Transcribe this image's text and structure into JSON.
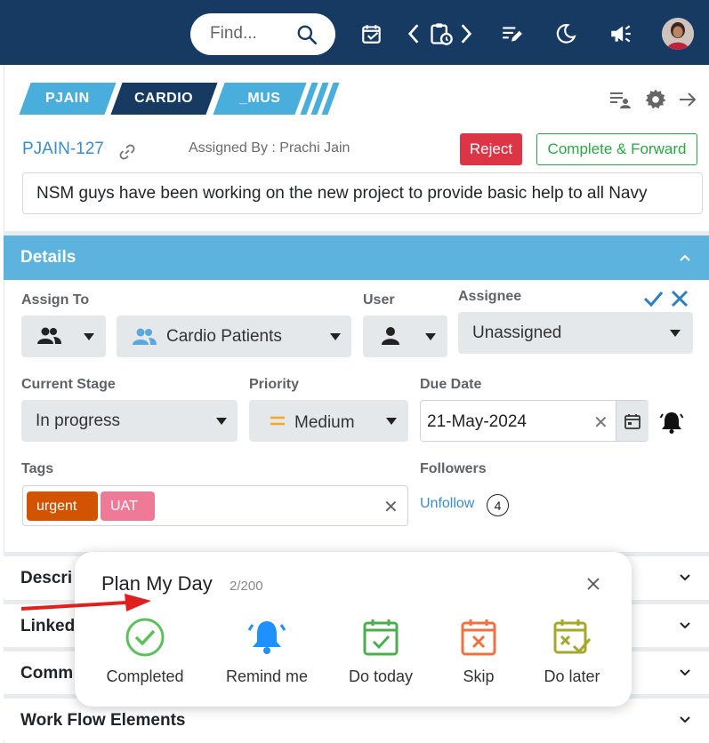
{
  "topbar": {
    "search_placeholder": "Find...",
    "icons": [
      "search-icon",
      "calendar-check-icon",
      "chevron-left-icon",
      "clipboard-clock-icon",
      "chevron-right-icon",
      "list-edit-icon",
      "moon-icon",
      "megaphone-icon"
    ]
  },
  "task": {
    "chips": [
      "PJAIN",
      "CARDIO",
      "_MUS"
    ],
    "id": "PJAIN-127",
    "assigned_by": "Assigned By : Prachi Jain",
    "reject_label": "Reject",
    "complete_label": "Complete & Forward",
    "title": "NSM guys have been working on the new project to provide basic help to all Navy"
  },
  "details": {
    "header": "Details",
    "assign_to_label": "Assign To",
    "assign_to_value": "Cardio Patients",
    "user_label": "User",
    "assignee_label": "Assignee",
    "assignee_value": "Unassigned",
    "stage_label": "Current Stage",
    "stage_value": "In progress",
    "priority_label": "Priority",
    "priority_value": "Medium",
    "due_label": "Due Date",
    "due_value": "21-May-2024",
    "tags_label": "Tags",
    "tags": [
      "urgent",
      "UAT"
    ],
    "followers_label": "Followers",
    "unfollow_label": "Unfollow",
    "follower_count": "4"
  },
  "accordions": [
    "Descri",
    "Linked",
    "Comm",
    "Work Flow Elements"
  ],
  "popup": {
    "title": "Plan My Day",
    "count": "2/200",
    "actions": [
      "Completed",
      "Remind me",
      "Do today",
      "Skip",
      "Do later"
    ]
  },
  "colors": {
    "navbar": "#173a63",
    "accent": "#5cb3de",
    "reject": "#dc3545",
    "complete": "#28a745",
    "tag_urgent": "#d35400",
    "tag_uat": "#ee7a98"
  }
}
